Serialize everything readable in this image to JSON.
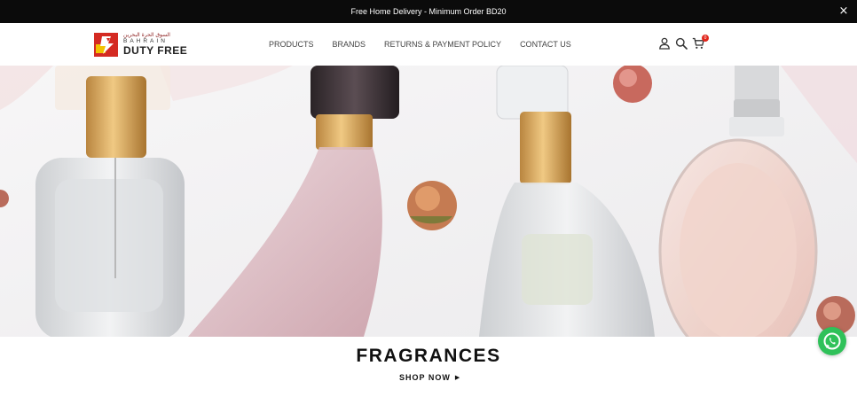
{
  "topbar": {
    "announcement": "Free Home Delivery - Minimum Order BD20",
    "close_glyph": "×"
  },
  "brand": {
    "arabic_text": "السوق الحرة البحرين",
    "line1": "BAHRAIN",
    "line2": "DUTY FREE",
    "colors": {
      "red": "#d42a22",
      "yellow": "#f2c200"
    }
  },
  "nav": {
    "items": [
      "PRODUCTS",
      "BRANDS",
      "RETURNS & PAYMENT POLICY",
      "CONTACT US"
    ]
  },
  "header_icons": {
    "account": "user-icon",
    "search": "search-icon",
    "cart": "cart-icon",
    "cart_count": "0"
  },
  "hero": {
    "image": "perfume-bottles-photo"
  },
  "section": {
    "title": "FRAGRANCES",
    "cta": "SHOP NOW",
    "cta_arrow": "▶"
  },
  "chat": {
    "icon": "whatsapp-icon",
    "color": "#2fc159"
  }
}
